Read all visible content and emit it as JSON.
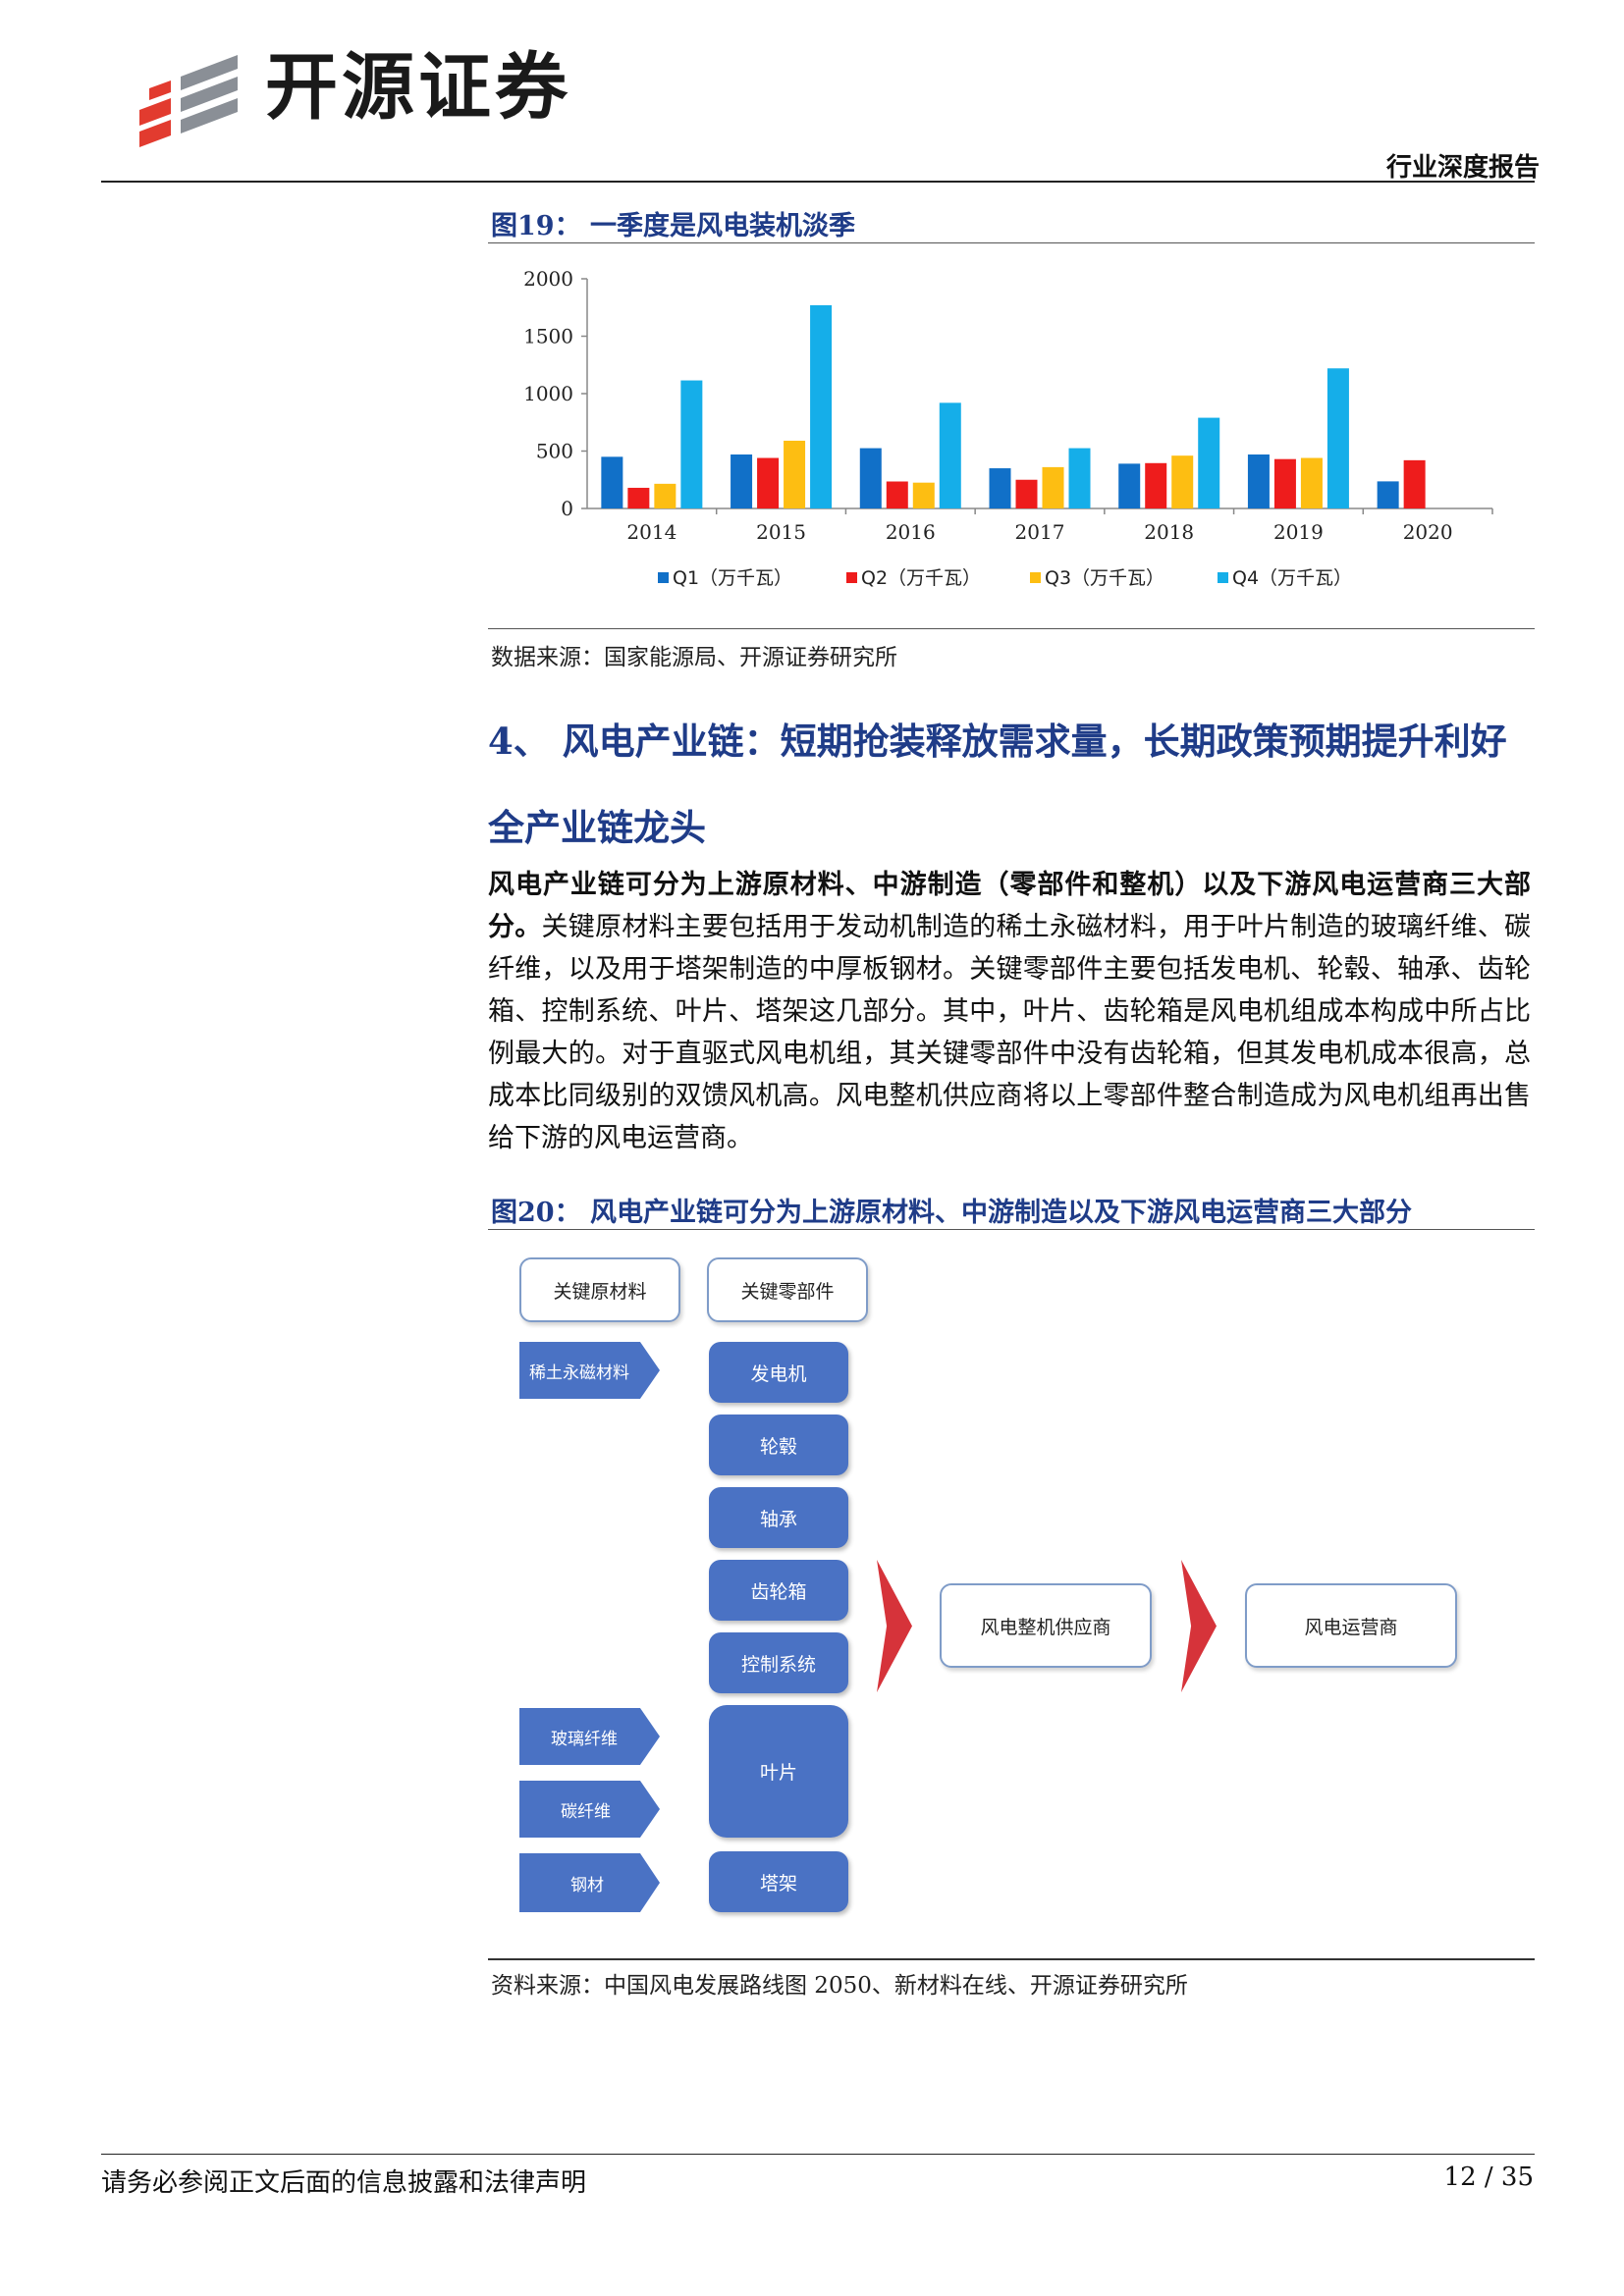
{
  "header": {
    "company_name": "开源证券",
    "report_type": "行业深度报告"
  },
  "figure19": {
    "title": "图19：  一季度是风电装机淡季",
    "source": "数据来源：国家能源局、开源证券研究所"
  },
  "chart_data": {
    "type": "bar",
    "categories": [
      "2014",
      "2015",
      "2016",
      "2017",
      "2018",
      "2019",
      "2020"
    ],
    "series": [
      {
        "name": "Q1（万千瓦）",
        "color": "#1170c8",
        "values": [
          450,
          470,
          525,
          350,
          390,
          470,
          236
        ]
      },
      {
        "name": "Q2（万千瓦）",
        "color": "#ee1c1c",
        "values": [
          180,
          440,
          235,
          250,
          395,
          430,
          420
        ]
      },
      {
        "name": "Q3（万千瓦）",
        "color": "#fdbe12",
        "values": [
          215,
          590,
          225,
          360,
          460,
          440,
          null
        ]
      },
      {
        "name": "Q4（万千瓦）",
        "color": "#15aee9",
        "values": [
          1115,
          1770,
          920,
          525,
          790,
          1220,
          null
        ]
      }
    ],
    "y_ticks": [
      "0",
      "500",
      "1000",
      "1500",
      "2000"
    ],
    "ylim": [
      0,
      2000
    ],
    "legend_position": "bottom"
  },
  "section4": {
    "heading_line1": "4、 风电产业链：短期抢装释放需求量，长期政策预期提升利好",
    "heading_line2": "全产业链龙头",
    "para_bold": "风电产业链可分为上游原材料、中游制造（零部件和整机）以及下游风电运营商三大部分。",
    "para_rest": "关键原材料主要包括用于发动机制造的稀土永磁材料，用于叶片制造的玻璃纤维、碳纤维，以及用于塔架制造的中厚板钢材。关键零部件主要包括发电机、轮毂、轴承、齿轮箱、控制系统、叶片、塔架这几部分。其中，叶片、齿轮箱是风电机组成本构成中所占比例最大的。对于直驱式风电机组，其关键零部件中没有齿轮箱，但其发电机成本很高，总成本比同级别的双馈风机高。风电整机供应商将以上零部件整合制造成为风电机组再出售给下游的风电运营商。"
  },
  "figure20": {
    "title": "图20：  风电产业链可分为上游原材料、中游制造以及下游风电运营商三大部分",
    "source": "资料来源：中国风电发展路线图 2050、新材料在线、开源证券研究所",
    "header_materials": "关键原材料",
    "header_components": "关键零部件",
    "materials": [
      "稀土永磁材料",
      "玻璃纤维",
      "碳纤维",
      "钢材"
    ],
    "components": [
      "发电机",
      "轮毂",
      "轴承",
      "齿轮箱",
      "控制系统",
      "叶片",
      "塔架"
    ],
    "manufacturer": "风电整机供应商",
    "operator": "风电运营商"
  },
  "footer": {
    "disclaimer": "请务必参阅正文后面的信息披露和法律声明",
    "page": "12 / 35"
  }
}
